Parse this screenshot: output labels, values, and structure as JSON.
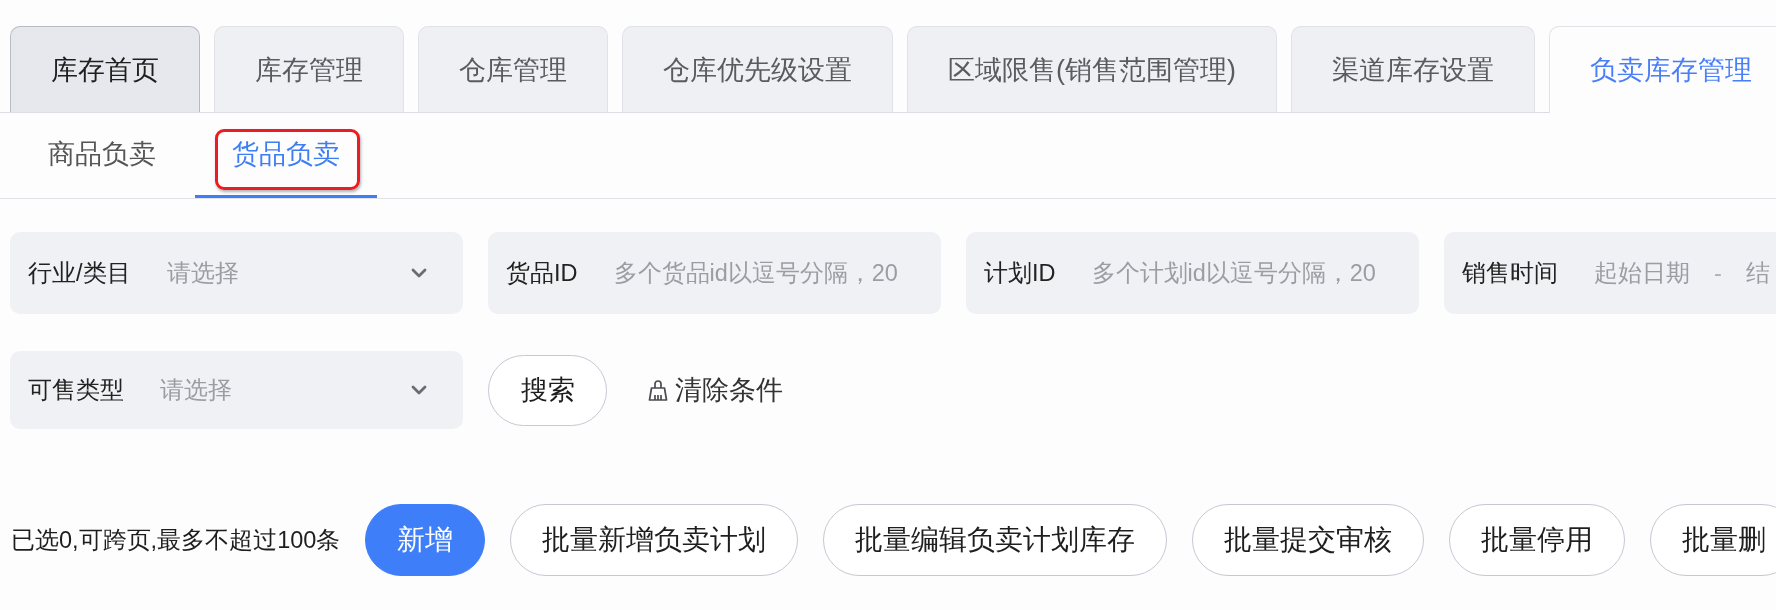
{
  "tabs": [
    {
      "label": "库存首页",
      "selected": false,
      "hovered": true
    },
    {
      "label": "库存管理",
      "selected": false,
      "hovered": false
    },
    {
      "label": "仓库管理",
      "selected": false,
      "hovered": false
    },
    {
      "label": "仓库优先级设置",
      "selected": false,
      "hovered": false
    },
    {
      "label": "区域限售(销售范围管理)",
      "selected": false,
      "hovered": false
    },
    {
      "label": "渠道库存设置",
      "selected": false,
      "hovered": false
    },
    {
      "label": "负卖库存管理",
      "selected": true,
      "hovered": false
    }
  ],
  "subtabs": [
    {
      "label": "商品负卖",
      "selected": false,
      "highlighted": false
    },
    {
      "label": "货品负卖",
      "selected": true,
      "highlighted": true
    }
  ],
  "filter_rows": [
    {
      "fields": [
        {
          "kind": "select",
          "label": "行业/类目",
          "placeholder": "请选择"
        },
        {
          "kind": "text",
          "label": "货品ID",
          "placeholder": "多个货品id以逗号分隔，20"
        },
        {
          "kind": "text",
          "label": "计划ID",
          "placeholder": "多个计划id以逗号分隔，20"
        },
        {
          "kind": "date_range",
          "label": "销售时间",
          "start": {
            "placeholder": "起始日期"
          },
          "separator": "-",
          "end": {
            "placeholder": "结"
          }
        }
      ]
    },
    {
      "fields": [
        {
          "kind": "select",
          "label": "可售类型",
          "placeholder": "请选择"
        }
      ],
      "search_button": {
        "label": "搜索"
      },
      "clear_button": {
        "label": "清除条件"
      }
    }
  ],
  "selection_note": "已选0,可跨页,最多不超过100条",
  "actions": [
    {
      "label": "新增",
      "kind": "primary"
    },
    {
      "label": "批量新增负卖计划",
      "kind": "default"
    },
    {
      "label": "批量编辑负卖计划库存",
      "kind": "default"
    },
    {
      "label": "批量提交审核",
      "kind": "default"
    },
    {
      "label": "批量停用",
      "kind": "default"
    },
    {
      "label": "批量删",
      "kind": "default"
    }
  ]
}
